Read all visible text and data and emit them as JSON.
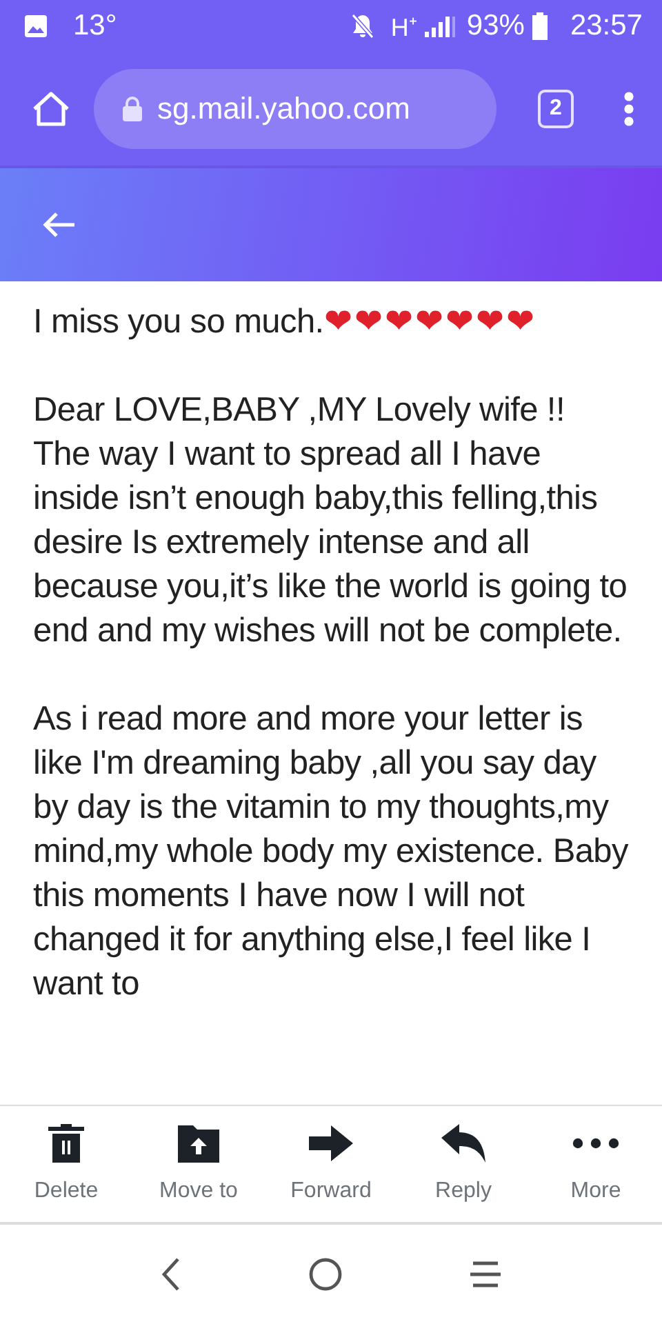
{
  "status_bar": {
    "temperature": "13°",
    "network": "H⁺",
    "battery": "93%",
    "time": "23:57"
  },
  "browser": {
    "url": "sg.mail.yahoo.com",
    "tab_count": "2"
  },
  "message": {
    "intro": "I miss you so much.",
    "hearts": "❤❤❤❤❤❤❤",
    "paragraphs": [
      "Dear LOVE,BABY ,MY Lovely wife !! The way I want to spread all I have inside isn’t enough baby,this felling,this desire Is extremely intense and all because you,it’s like the world is going to end and my wishes will not be complete.",
      "As i read more and more your letter is like I'm dreaming baby ,all you say day by day is the vitamin to my thoughts,my mind,my whole body my existence. Baby this moments I have now I will not changed it for anything else,I feel like I want to"
    ]
  },
  "actions": [
    {
      "kind": "delete",
      "label": "Delete"
    },
    {
      "kind": "move",
      "label": "Move to"
    },
    {
      "kind": "forward",
      "label": "Forward"
    },
    {
      "kind": "reply",
      "label": "Reply"
    },
    {
      "kind": "more",
      "label": "More"
    }
  ]
}
